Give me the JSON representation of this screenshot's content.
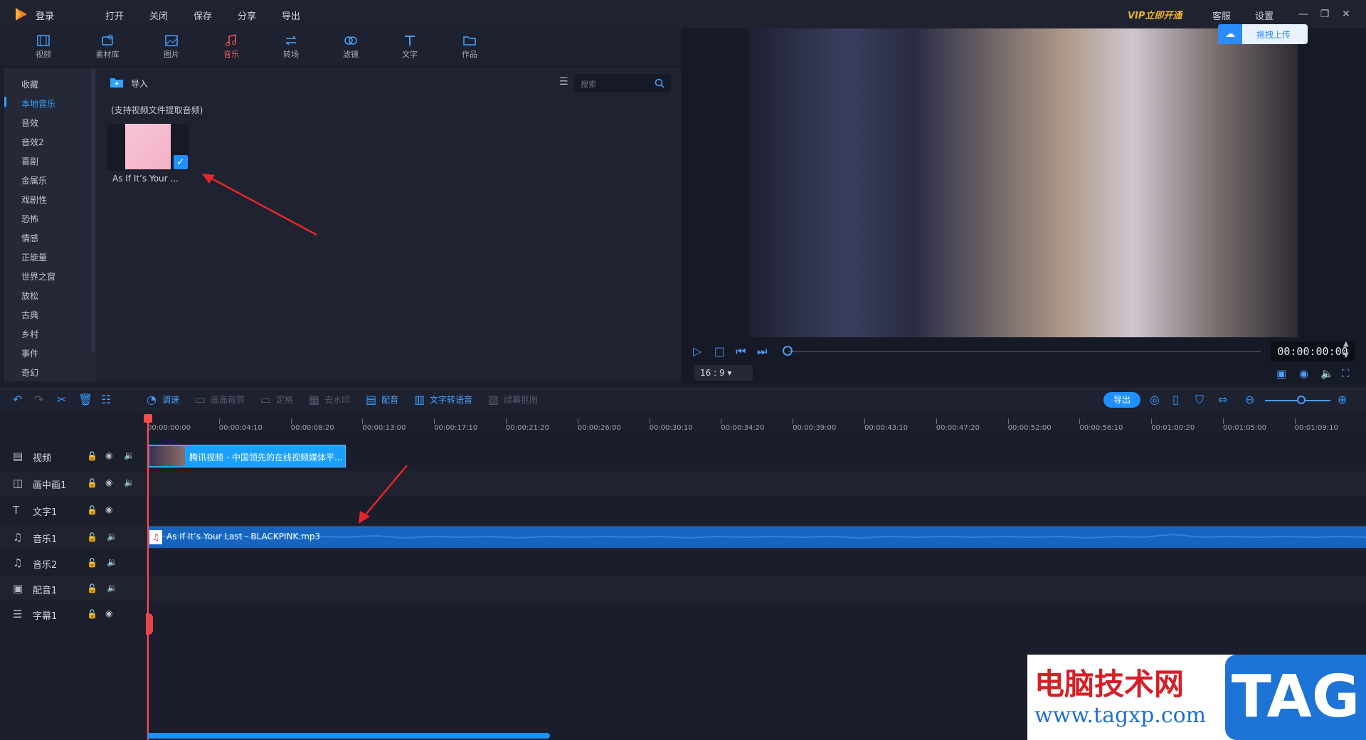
{
  "app": {
    "login_label": "登录",
    "menu": [
      "打开",
      "关闭",
      "保存",
      "分享",
      "导出"
    ],
    "vip_label": "VIP立即开通",
    "support_label": "客服",
    "settings_label": "设置"
  },
  "tabs": [
    {
      "label": "视频",
      "icon": "film-icon"
    },
    {
      "label": "素材库",
      "icon": "library-icon"
    },
    {
      "label": "图片",
      "icon": "image-icon"
    },
    {
      "label": "音乐",
      "icon": "music-icon",
      "active": true
    },
    {
      "label": "转场",
      "icon": "transition-icon"
    },
    {
      "label": "滤镜",
      "icon": "filter-icon"
    },
    {
      "label": "文字",
      "icon": "text-icon"
    },
    {
      "label": "作品",
      "icon": "folder-icon"
    }
  ],
  "categories": [
    "收藏",
    "本地音乐",
    "音效",
    "音效2",
    "喜剧",
    "金属乐",
    "戏剧性",
    "恐怖",
    "情感",
    "正能量",
    "世界之窗",
    "放松",
    "古典",
    "乡村",
    "事件",
    "奇幻"
  ],
  "active_category": "本地音乐",
  "library": {
    "import_label": "导入",
    "search_placeholder": "搜索",
    "hint": "(支持视频文件提取音频)",
    "item_label": "As If It’s Your ..."
  },
  "preview": {
    "cloud_upload_label": "拖拽上传",
    "timecode": "00:00:00:00",
    "aspect_ratio": "16 : 9"
  },
  "toolbar": {
    "adjust": "调速",
    "crop": "画面裁剪",
    "freeze": "定格",
    "watermark": "去水印",
    "dubbing": "配音",
    "tts": "文字转语音",
    "green_screen": "绿幕抠图",
    "export": "导出"
  },
  "ruler_ticks": [
    "00:00:00:00",
    "00:00:04:10",
    "00:00:08:20",
    "00:00:13:00",
    "00:00:17:10",
    "00:00:21:20",
    "00:00:26:00",
    "00:00:30:10",
    "00:00:34:20",
    "00:00:39:00",
    "00:00:43:10",
    "00:00:47:20",
    "00:00:52:00",
    "00:00:56:10",
    "00:01:00:20",
    "00:01:05:00",
    "00:01:09:10"
  ],
  "tracks": [
    {
      "name": "视频",
      "icon": "film-icon"
    },
    {
      "name": "画中画1",
      "icon": "pip-icon"
    },
    {
      "name": "文字1",
      "icon": "text-icon"
    },
    {
      "name": "音乐1",
      "icon": "music-icon"
    },
    {
      "name": "音乐2",
      "icon": "music-icon"
    },
    {
      "name": "配音1",
      "icon": "mic-icon"
    },
    {
      "name": "字幕1",
      "icon": "subtitle-icon"
    }
  ],
  "clips": {
    "video": "腾讯视频 - 中国领先的在线视频媒体平...",
    "audio": "As If It’s Your Last - BLACKPINK.mp3"
  },
  "watermark": {
    "cn": "电脑技术网",
    "url": "www.tagxp.com",
    "tag": "TAG"
  }
}
